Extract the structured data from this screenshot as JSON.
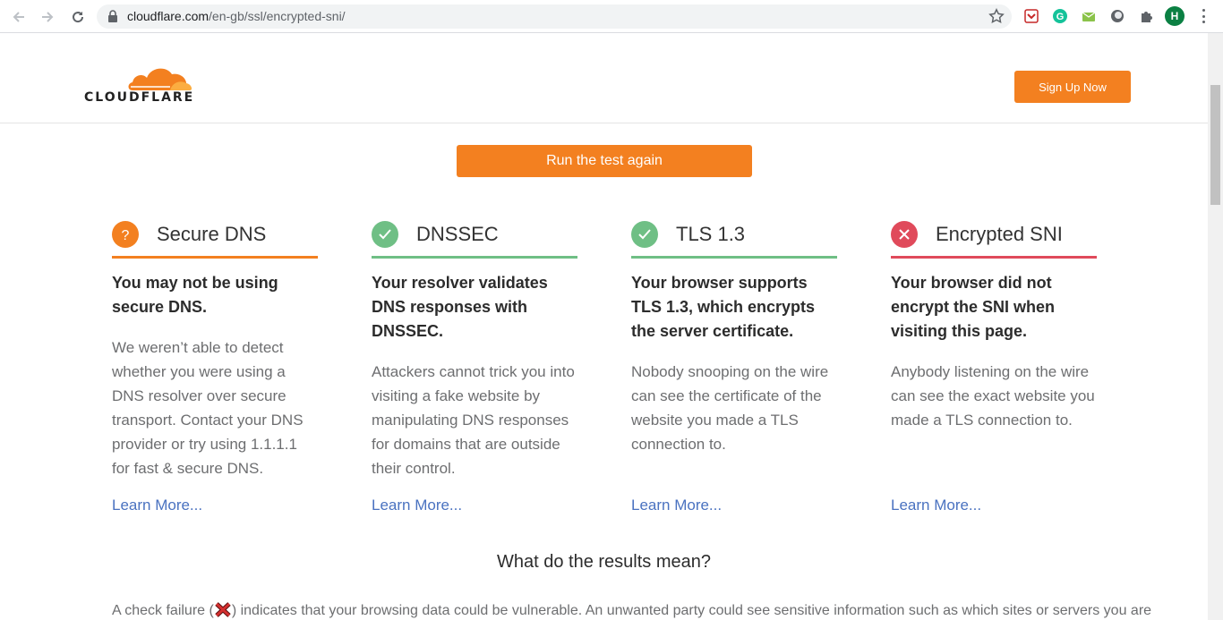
{
  "browser": {
    "url_domain": "cloudflare.com",
    "url_path": "/en-gb/ssl/encrypted-sni/",
    "profile_initial": "H"
  },
  "header": {
    "logo_text": "CLOUDFLARE",
    "signup_label": "Sign Up Now"
  },
  "run_again_label": "Run the test again",
  "cards": [
    {
      "title": "Secure DNS",
      "status": "unknown",
      "color": "#f38020",
      "headline": "You may not be using secure DNS.",
      "description": "We weren’t able to detect whether you were using a DNS resolver over secure transport. Contact your DNS provider or try using 1.1.1.1 for fast & secure DNS.",
      "learn_more": "Learn More..."
    },
    {
      "title": "DNSSEC",
      "status": "pass",
      "color": "#6fbf85",
      "headline": "Your resolver validates DNS responses with DNSSEC.",
      "description": "Attackers cannot trick you into visiting a fake website by manipulating DNS responses for domains that are outside their control.",
      "learn_more": "Learn More..."
    },
    {
      "title": "TLS 1.3",
      "status": "pass",
      "color": "#6fbf85",
      "headline": "Your browser supports TLS 1.3, which encrypts the server certificate.",
      "description": "Nobody snooping on the wire can see the certificate of the website you made a TLS connection to.",
      "learn_more": "Learn More..."
    },
    {
      "title": "Encrypted SNI",
      "status": "fail",
      "color": "#e04a5b",
      "headline": "Your browser did not encrypt the SNI when visiting this page.",
      "description": "Anybody listening on the wire can see the exact website you made a TLS connection to.",
      "learn_more": "Learn More..."
    }
  ],
  "results": {
    "title": "What do the results mean?",
    "text_before": "A check failure (",
    "text_after": ") indicates that your browsing data could be vulnerable. An unwanted party could see sensitive information such as which sites or servers you are"
  }
}
